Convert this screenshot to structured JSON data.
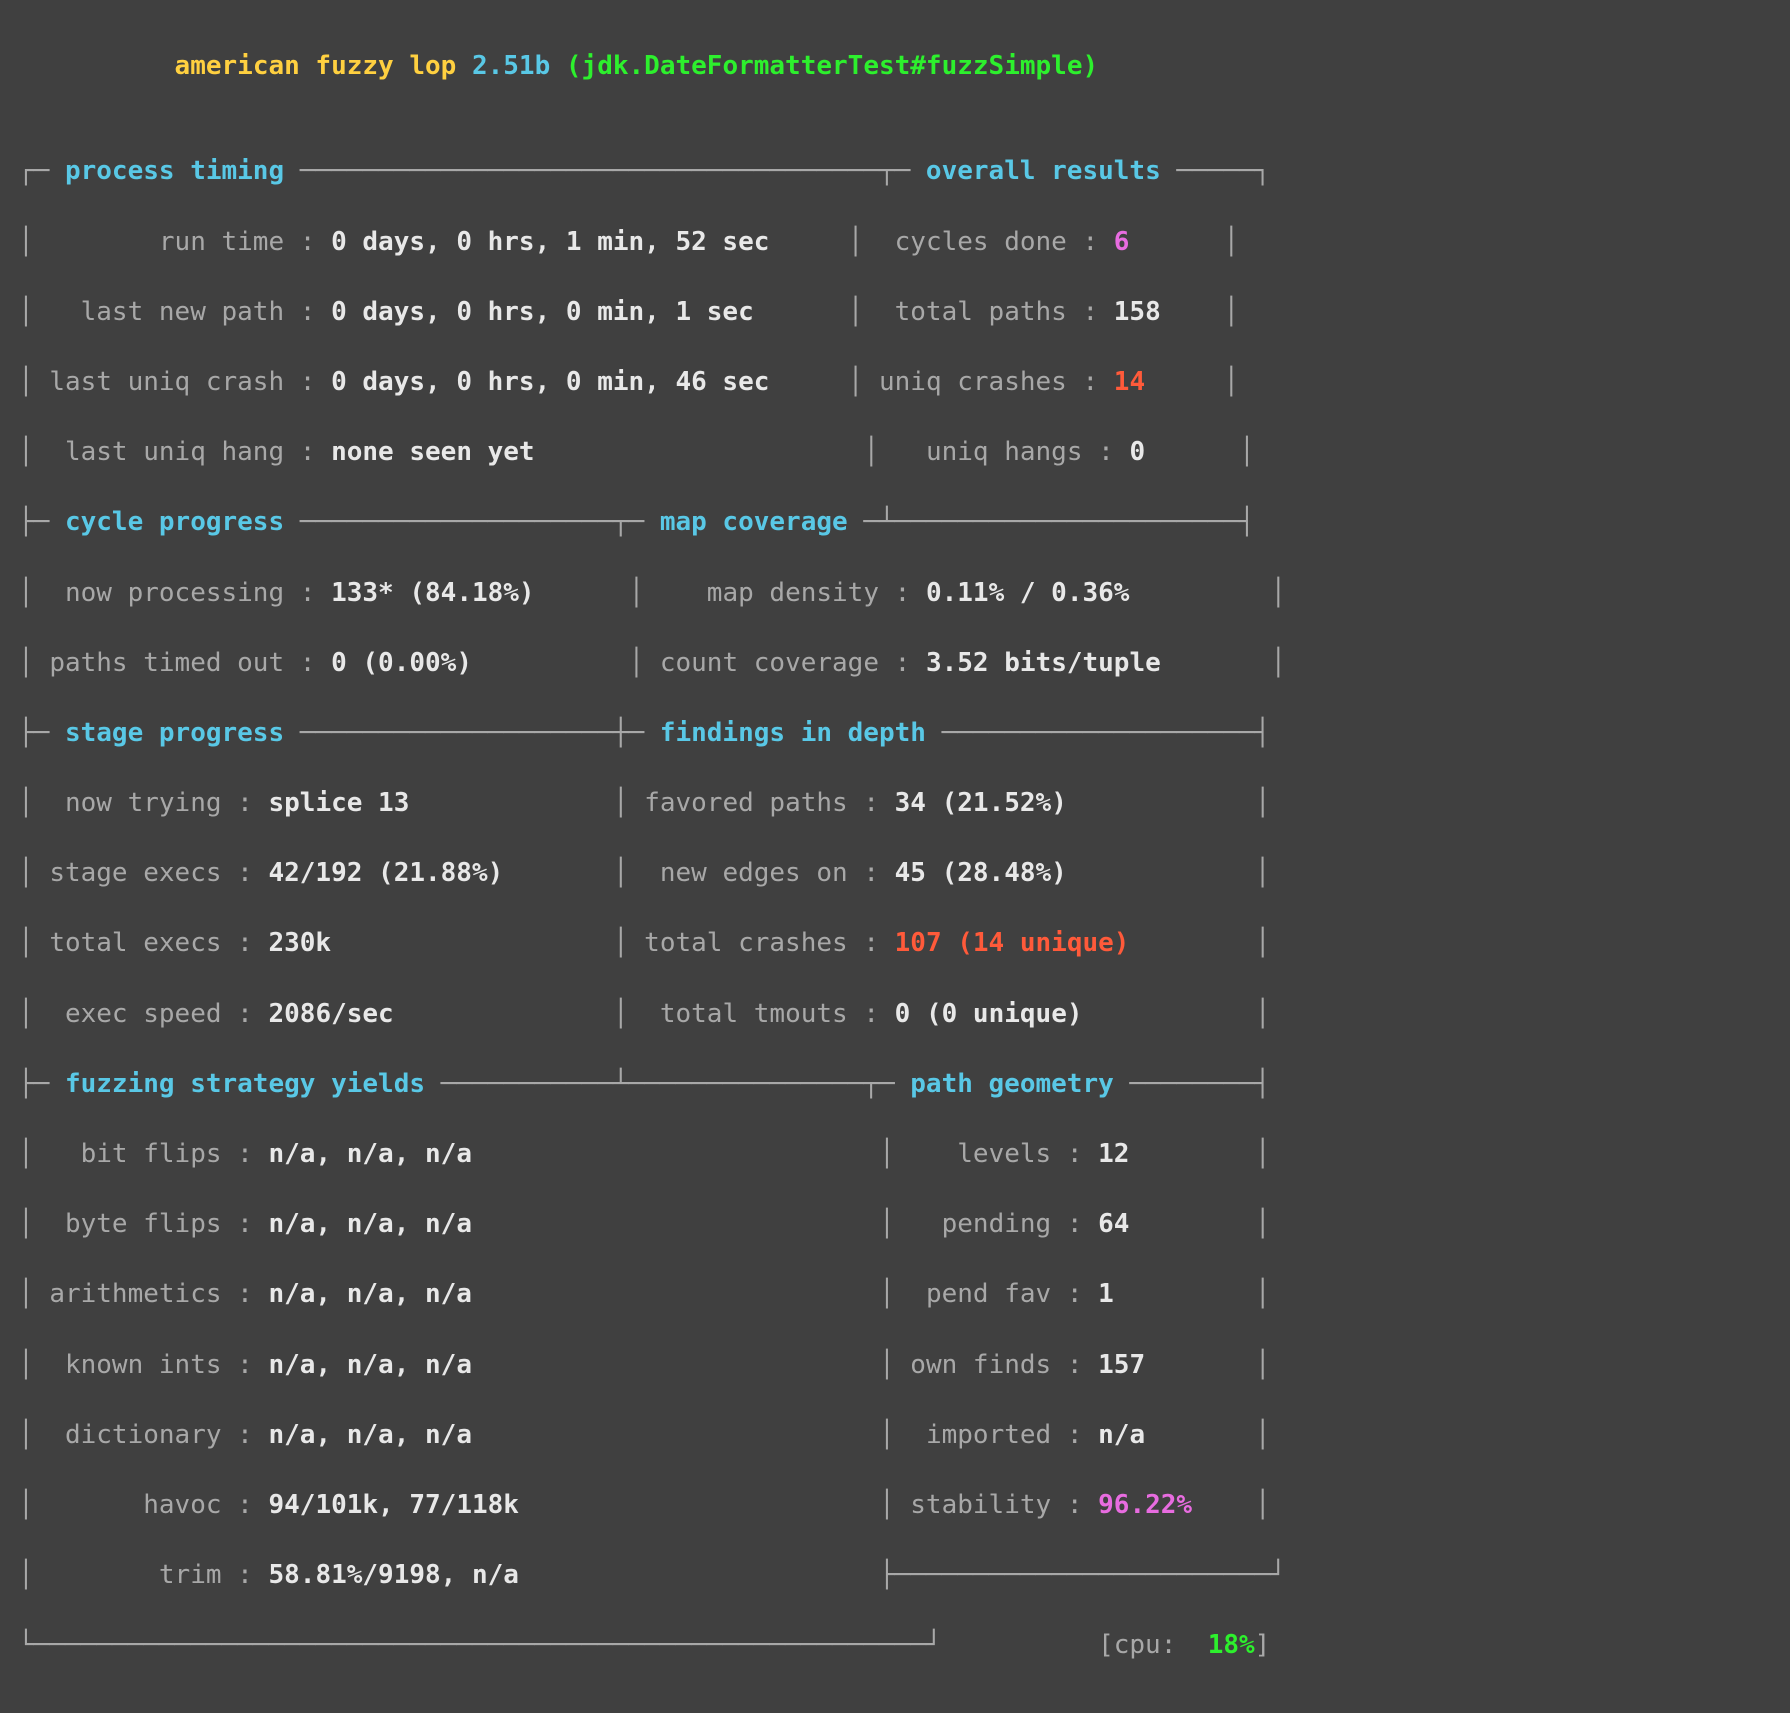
{
  "title": {
    "name": "american fuzzy lop",
    "version": "2.51b",
    "target": "(jdk.DateFormatterTest#fuzzSimple)"
  },
  "sections": {
    "process_timing": "process timing",
    "overall_results": "overall results",
    "cycle_progress": "cycle progress",
    "map_coverage": "map coverage",
    "stage_progress": "stage progress",
    "findings_in_depth": "findings in depth",
    "fuzzing_strategy_yields": "fuzzing strategy yields",
    "path_geometry": "path geometry"
  },
  "process_timing": {
    "run_time_label": "run time",
    "run_time": "0 days, 0 hrs, 1 min, 52 sec",
    "last_new_path_label": "last new path",
    "last_new_path": "0 days, 0 hrs, 0 min, 1 sec",
    "last_uniq_crash_label": "last uniq crash",
    "last_uniq_crash": "0 days, 0 hrs, 0 min, 46 sec",
    "last_uniq_hang_label": "last uniq hang",
    "last_uniq_hang": "none seen yet"
  },
  "overall_results": {
    "cycles_done_label": "cycles done",
    "cycles_done": "6",
    "total_paths_label": "total paths",
    "total_paths": "158",
    "uniq_crashes_label": "uniq crashes",
    "uniq_crashes": "14",
    "uniq_hangs_label": "uniq hangs",
    "uniq_hangs": "0"
  },
  "cycle_progress": {
    "now_processing_label": "now processing",
    "now_processing": "133* (84.18%)",
    "paths_timed_out_label": "paths timed out",
    "paths_timed_out": "0 (0.00%)"
  },
  "map_coverage": {
    "map_density_label": "map density",
    "map_density": "0.11% / 0.36%",
    "count_coverage_label": "count coverage",
    "count_coverage": "3.52 bits/tuple"
  },
  "stage_progress": {
    "now_trying_label": "now trying",
    "now_trying": "splice 13",
    "stage_execs_label": "stage execs",
    "stage_execs": "42/192 (21.88%)",
    "total_execs_label": "total execs",
    "total_execs": "230k",
    "exec_speed_label": "exec speed",
    "exec_speed": "2086/sec"
  },
  "findings_in_depth": {
    "favored_paths_label": "favored paths",
    "favored_paths": "34 (21.52%)",
    "new_edges_on_label": "new edges on",
    "new_edges_on": "45 (28.48%)",
    "total_crashes_label": "total crashes",
    "total_crashes": "107 (14 unique)",
    "total_tmouts_label": "total tmouts",
    "total_tmouts": "0 (0 unique)"
  },
  "fuzzing_strategy_yields": {
    "bit_flips_label": "bit flips",
    "bit_flips": "n/a, n/a, n/a",
    "byte_flips_label": "byte flips",
    "byte_flips": "n/a, n/a, n/a",
    "arithmetics_label": "arithmetics",
    "arithmetics": "n/a, n/a, n/a",
    "known_ints_label": "known ints",
    "known_ints": "n/a, n/a, n/a",
    "dictionary_label": "dictionary",
    "dictionary": "n/a, n/a, n/a",
    "havoc_label": "havoc",
    "havoc": "94/101k, 77/118k",
    "trim_label": "trim",
    "trim": "58.81%/9198, n/a"
  },
  "path_geometry": {
    "levels_label": "levels",
    "levels": "12",
    "pending_label": "pending",
    "pending": "64",
    "pend_fav_label": "pend fav",
    "pend_fav": "1",
    "own_finds_label": "own finds",
    "own_finds": "157",
    "imported_label": "imported",
    "imported": "n/a",
    "stability_label": "stability",
    "stability": "96.22%"
  },
  "cpu": {
    "label": "cpu:",
    "value": "18%"
  }
}
